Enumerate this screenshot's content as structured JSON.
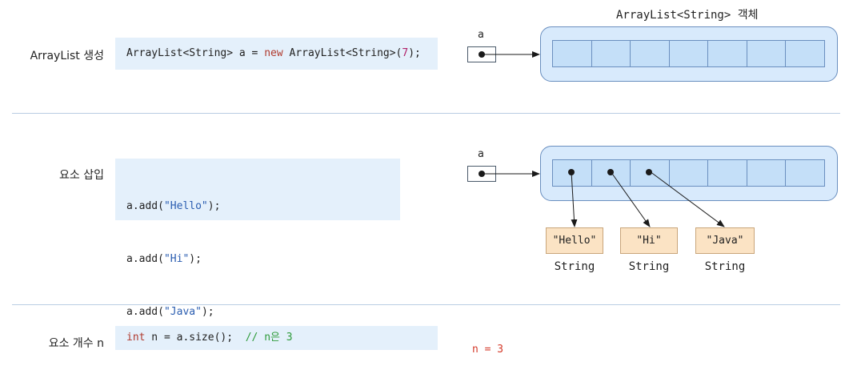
{
  "rows": [
    {
      "label": "ArrayList 생성"
    },
    {
      "label": "요소 삽입"
    },
    {
      "label": "요소 개수 n"
    }
  ],
  "code": {
    "create": {
      "p1": "ArrayList<String> a = ",
      "kw": "new",
      "p2": " ArrayList<String>(",
      "num": "7",
      "p3": ");"
    },
    "add": [
      {
        "pre": "a.add(",
        "str": "\"Hello\"",
        "post": ");"
      },
      {
        "pre": "a.add(",
        "str": "\"Hi\"",
        "post": ");"
      },
      {
        "pre": "a.add(",
        "str": "\"Java\"",
        "post": ");"
      }
    ],
    "size": {
      "kw": "int",
      "p1": " n = a.size();  ",
      "cmt": "// n은 3"
    }
  },
  "diagram": {
    "object_title": "ArrayList<String> 객체",
    "var_name": "a",
    "capacity": 7,
    "strings": [
      {
        "value": "\"Hello\"",
        "type": "String"
      },
      {
        "value": "\"Hi\"",
        "type": "String"
      },
      {
        "value": "\"Java\"",
        "type": "String"
      }
    ]
  },
  "result": "n = 3"
}
